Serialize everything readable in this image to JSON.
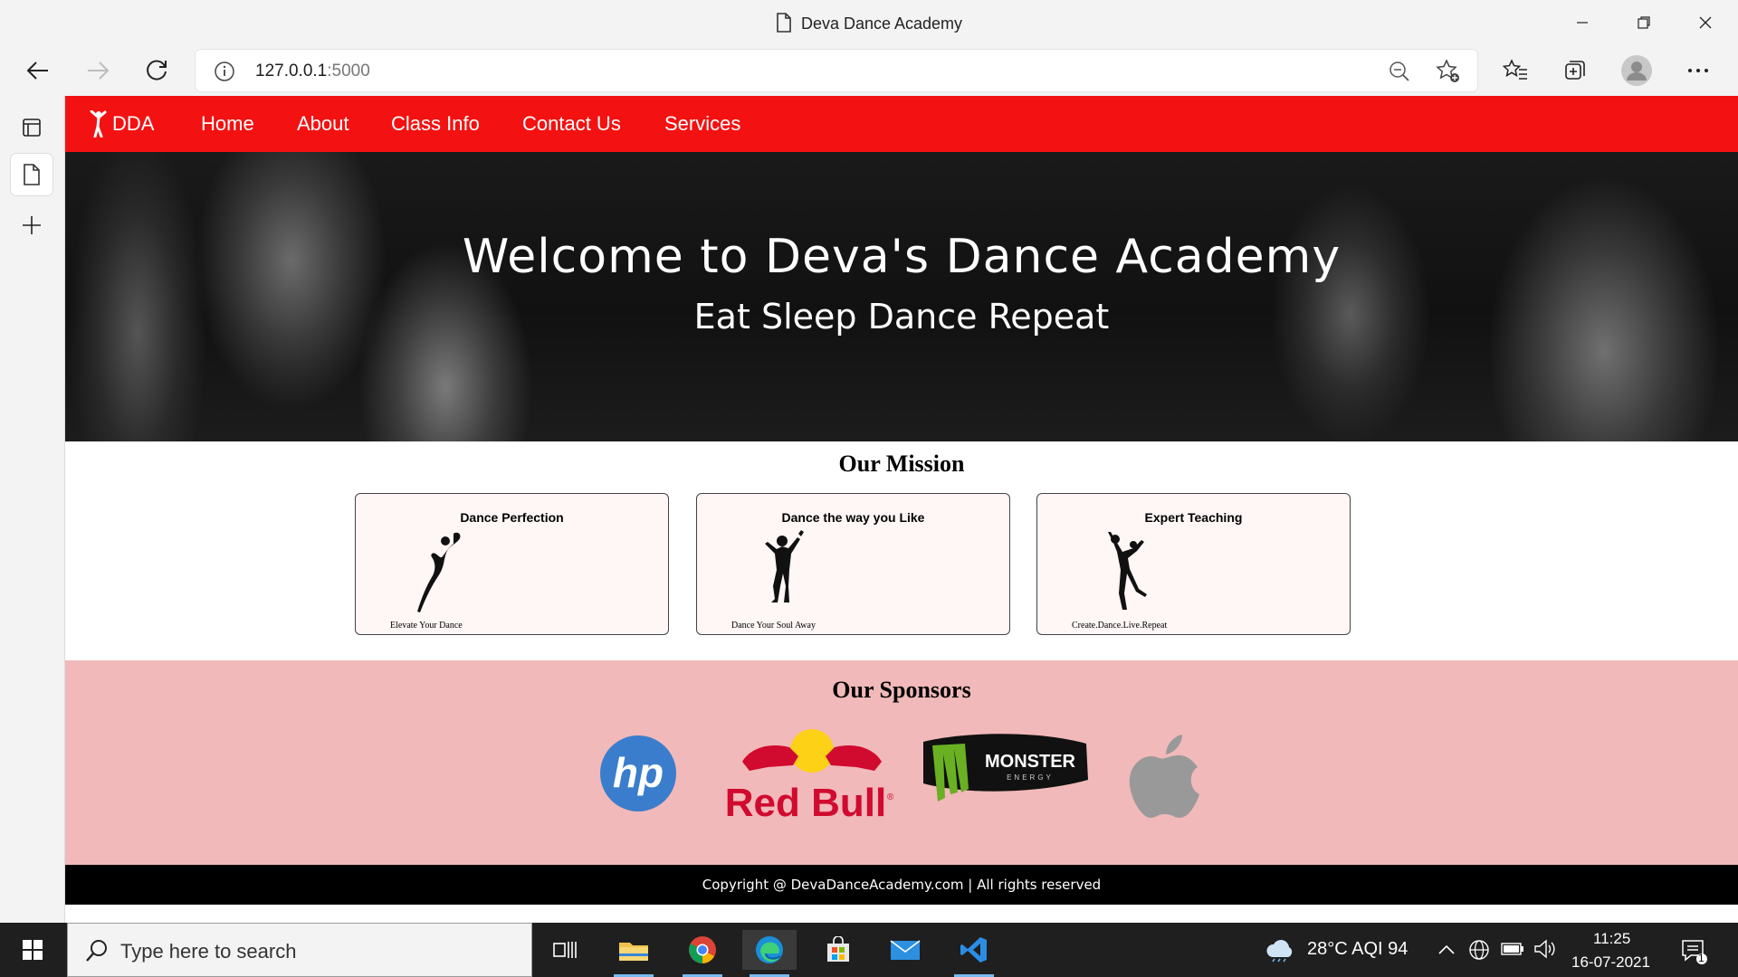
{
  "window": {
    "title": "Deva Dance Academy"
  },
  "browser": {
    "url_host": "127.0.0.1",
    "url_port": ":5000"
  },
  "site": {
    "brand": "DDA",
    "nav": [
      "Home",
      "About",
      "Class Info",
      "Contact Us",
      "Services"
    ],
    "hero_title": "Welcome to Deva's Dance Academy",
    "hero_subtitle": "Eat Sleep Dance Repeat",
    "mission_title": "Our Mission",
    "cards": [
      {
        "title": "Dance Perfection",
        "caption": "Elevate Your Dance"
      },
      {
        "title": "Dance the way you Like",
        "caption": "Dance Your Soul Away"
      },
      {
        "title": "Expert Teaching",
        "caption": "Create.Dance.Live.Repeat"
      }
    ],
    "sponsors_title": "Our Sponsors",
    "sponsors": [
      "hp",
      "Red Bull",
      "MONSTER",
      "ENERGY"
    ],
    "footer": "Copyright @ DevaDanceAcademy.com | All rights reserved",
    "accent_color": "#f41111",
    "sponsor_bg": "#f1b9b9"
  },
  "taskbar": {
    "search_placeholder": "Type here to search",
    "weather": "28°C  AQI 94",
    "time": "11:25",
    "date": "16-07-2021",
    "notification_count": "1"
  }
}
